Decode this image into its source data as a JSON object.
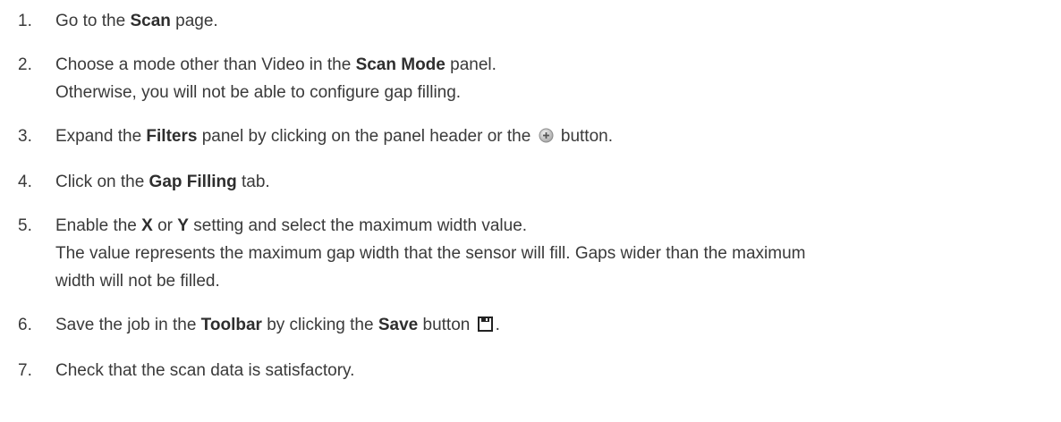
{
  "steps": [
    {
      "num": "1.",
      "pre": "Go to the ",
      "bold": "Scan",
      "post": " page."
    },
    {
      "num": "2.",
      "pre": "Choose a mode other than Video in the ",
      "bold": "Scan Mode",
      "post": " panel.",
      "sub": "Otherwise, you will not be able to configure gap filling."
    },
    {
      "num": "3.",
      "pre": "Expand the ",
      "bold": "Filters",
      "mid": " panel by clicking on the panel header or the ",
      "post": " button.",
      "icon": "expand-plus-icon"
    },
    {
      "num": "4.",
      "pre": "Click on the ",
      "bold": "Gap Filling",
      "post": " tab."
    },
    {
      "num": "5.",
      "pre": "Enable the ",
      "bold": "X",
      "mid": " or ",
      "bold2": "Y",
      "post": " setting and select the maximum width value.",
      "sub": "The value represents the maximum gap width that the sensor will fill. Gaps wider than the maximum",
      "sub2": "width will not be filled."
    },
    {
      "num": "6.",
      "pre": "Save the job in the ",
      "bold": "Toolbar",
      "mid": " by clicking the ",
      "bold2": "Save",
      "mid2": " button ",
      "post": ".",
      "icon": "save-icon"
    },
    {
      "num": "7.",
      "pre": "Check that the scan data is satisfactory."
    }
  ]
}
